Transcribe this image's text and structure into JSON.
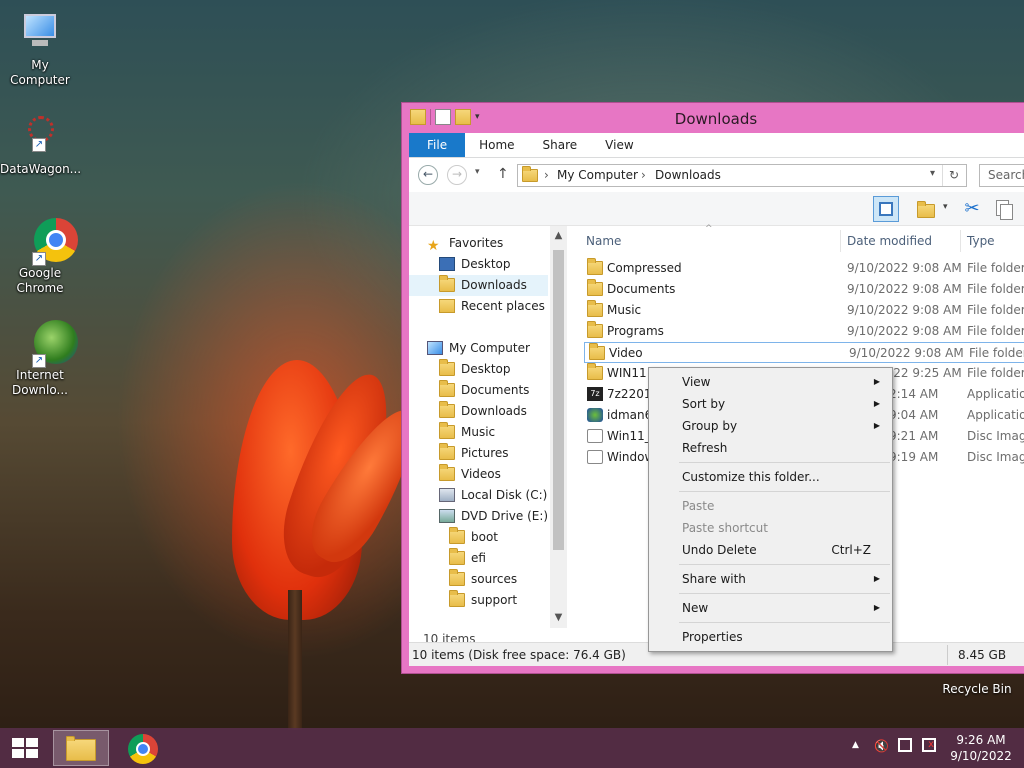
{
  "desktop": {
    "icons": [
      {
        "label": "My Computer"
      },
      {
        "label": "DataWagon..."
      },
      {
        "label": "Google Chrome"
      },
      {
        "label": "Internet Downlo..."
      }
    ],
    "recycle_bin": "Recycle Bin"
  },
  "window": {
    "title": "Downloads",
    "tabs": [
      "File",
      "Home",
      "Share",
      "View"
    ],
    "address": {
      "crumbs": [
        "My Computer",
        "Downloads"
      ],
      "separator": "›"
    },
    "search_placeholder": "Search",
    "nav": {
      "favorites_header": "Favorites",
      "favorites": [
        "Desktop",
        "Downloads",
        "Recent places"
      ],
      "computer_header": "My Computer",
      "computer": [
        "Desktop",
        "Documents",
        "Downloads",
        "Music",
        "Pictures",
        "Videos",
        "Local Disk (C:)",
        "DVD Drive (E:) ES"
      ],
      "dvd_children": [
        "boot",
        "efi",
        "sources",
        "support"
      ]
    },
    "columns": {
      "name": "Name",
      "date": "Date modified",
      "type": "Type"
    },
    "files": [
      {
        "name": "Compressed",
        "date": "9/10/2022 9:08 AM",
        "type": "File folder",
        "icon": "folder"
      },
      {
        "name": "Documents",
        "date": "9/10/2022 9:08 AM",
        "type": "File folder",
        "icon": "folder"
      },
      {
        "name": "Music",
        "date": "9/10/2022 9:08 AM",
        "type": "File folder",
        "icon": "folder"
      },
      {
        "name": "Programs",
        "date": "9/10/2022 9:08 AM",
        "type": "File folder",
        "icon": "folder"
      },
      {
        "name": "Video",
        "date": "9/10/2022 9:08 AM",
        "type": "File folder",
        "icon": "folder"
      },
      {
        "name": "WIN11",
        "date": "9/10/2022 9:25 AM",
        "type": "File folder",
        "icon": "folder"
      },
      {
        "name": "7z2201-",
        "date": "2:14 AM",
        "type": "Application",
        "icon": "7zip"
      },
      {
        "name": "idman6",
        "date": "9:04 AM",
        "type": "Application",
        "icon": "idm"
      },
      {
        "name": "Win11_I",
        "date": "9:21 AM",
        "type": "Disc Image",
        "icon": "disc"
      },
      {
        "name": "Window",
        "date": "9:19 AM",
        "type": "Disc Image",
        "icon": "disc"
      }
    ],
    "item_count": "10 items",
    "status_left": "10 items (Disk free space: 76.4 GB)",
    "status_right": "8.45 GB"
  },
  "context_menu": {
    "items": [
      {
        "label": "View",
        "submenu": true,
        "disabled": false
      },
      {
        "label": "Sort by",
        "submenu": true,
        "disabled": false
      },
      {
        "label": "Group by",
        "submenu": true,
        "disabled": false
      },
      {
        "label": "Refresh",
        "submenu": false,
        "disabled": false
      },
      {
        "label": "Customize this folder...",
        "submenu": false,
        "disabled": false
      },
      {
        "label": "Paste",
        "submenu": false,
        "disabled": true
      },
      {
        "label": "Paste shortcut",
        "submenu": false,
        "disabled": true
      },
      {
        "label": "Undo Delete",
        "shortcut": "Ctrl+Z",
        "submenu": false,
        "disabled": false
      },
      {
        "label": "Share with",
        "submenu": true,
        "disabled": false
      },
      {
        "label": "New",
        "submenu": true,
        "disabled": false
      },
      {
        "label": "Properties",
        "submenu": false,
        "disabled": false
      }
    ]
  },
  "taskbar": {
    "time": "9:26 AM",
    "date": "9/10/2022",
    "tray_icons": [
      "show-hidden-icons",
      "volume-muted-icon",
      "network-icon",
      "action-center-icon"
    ]
  }
}
